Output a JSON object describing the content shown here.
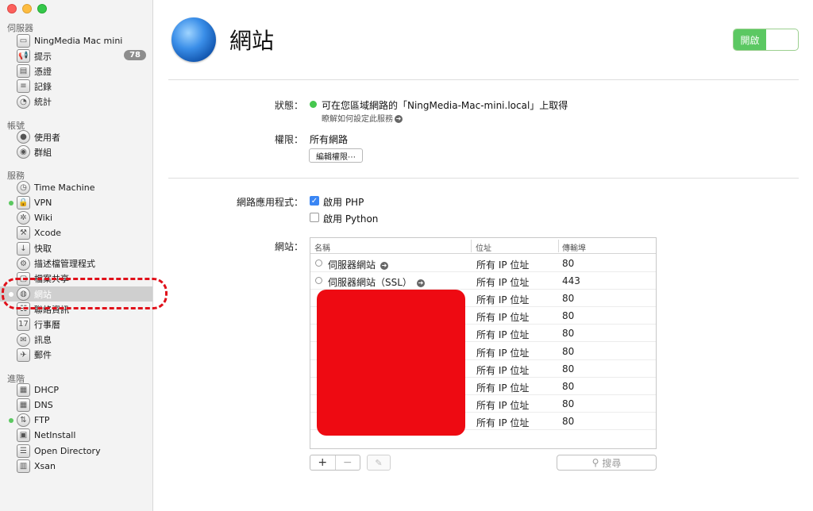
{
  "sidebar": {
    "sections": [
      {
        "label": "伺服器"
      },
      {
        "label": "帳號"
      },
      {
        "label": "服務"
      },
      {
        "label": "進階"
      }
    ],
    "server_items": [
      {
        "label": "NingMedia Mac mini",
        "icon": "mac-mini-icon"
      },
      {
        "label": "提示",
        "icon": "megaphone-icon",
        "badge": "78"
      },
      {
        "label": "憑證",
        "icon": "certificate-icon"
      },
      {
        "label": "記錄",
        "icon": "log-icon"
      },
      {
        "label": "統計",
        "icon": "stats-icon"
      }
    ],
    "account_items": [
      {
        "label": "使用者",
        "icon": "user-icon"
      },
      {
        "label": "群組",
        "icon": "group-icon"
      }
    ],
    "service_items": [
      {
        "label": "Time Machine",
        "icon": "time-machine-icon"
      },
      {
        "label": "VPN",
        "icon": "vpn-lock-icon",
        "active": true
      },
      {
        "label": "Wiki",
        "icon": "wiki-icon"
      },
      {
        "label": "Xcode",
        "icon": "xcode-icon"
      },
      {
        "label": "快取",
        "icon": "cache-icon"
      },
      {
        "label": "描述檔管理程式",
        "icon": "profile-manager-icon"
      },
      {
        "label": "檔案共享",
        "icon": "file-sharing-icon"
      },
      {
        "label": "網站",
        "icon": "globe-icon",
        "active": true,
        "selected": true
      },
      {
        "label": "聯絡資訊",
        "icon": "contacts-icon"
      },
      {
        "label": "行事曆",
        "icon": "calendar-icon"
      },
      {
        "label": "訊息",
        "icon": "messages-icon"
      },
      {
        "label": "郵件",
        "icon": "mail-icon"
      }
    ],
    "advanced_items": [
      {
        "label": "DHCP",
        "icon": "dhcp-icon"
      },
      {
        "label": "DNS",
        "icon": "dns-icon"
      },
      {
        "label": "FTP",
        "icon": "ftp-icon",
        "active": true
      },
      {
        "label": "NetInstall",
        "icon": "netinstall-icon"
      },
      {
        "label": "Open Directory",
        "icon": "open-directory-icon"
      },
      {
        "label": "Xsan",
        "icon": "xsan-icon"
      }
    ]
  },
  "header": {
    "title": "網站",
    "toggle_label": "開啟"
  },
  "status": {
    "label": "狀態：",
    "text": "可在您區域網路的「NingMedia-Mac-mini.local」上取得",
    "link": "瞭解如何設定此服務",
    "color": "#45c74e"
  },
  "permissions": {
    "label": "權限：",
    "value": "所有網路",
    "edit_button": "編輯權限⋯"
  },
  "webapps": {
    "label": "網路應用程式：",
    "php": {
      "label": "啟用 PHP",
      "checked": true
    },
    "python": {
      "label": "啟用 Python",
      "checked": false
    }
  },
  "sites": {
    "label": "網站：",
    "columns": [
      "名稱",
      "位址",
      "傳輸埠"
    ],
    "rows": [
      {
        "name": "伺服器網站",
        "address": "所有 IP 位址",
        "port": "80"
      },
      {
        "name": "伺服器網站（SSL）",
        "address": "所有 IP 位址",
        "port": "443"
      },
      {
        "name": "",
        "address": "所有 IP 位址",
        "port": "80"
      },
      {
        "name": "",
        "address": "所有 IP 位址",
        "port": "80"
      },
      {
        "name": "",
        "address": "所有 IP 位址",
        "port": "80"
      },
      {
        "name": "",
        "address": "所有 IP 位址",
        "port": "80"
      },
      {
        "name": "",
        "address": "所有 IP 位址",
        "port": "80"
      },
      {
        "name": "",
        "address": "所有 IP 位址",
        "port": "80"
      },
      {
        "name": "",
        "address": "所有 IP 位址",
        "port": "80"
      },
      {
        "name": "",
        "address": "所有 IP 位址",
        "port": "80"
      }
    ],
    "add_label": "+",
    "remove_label": "−",
    "search_placeholder": "搜尋"
  }
}
